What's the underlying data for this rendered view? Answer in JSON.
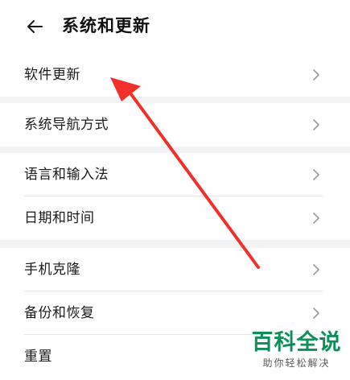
{
  "header": {
    "title": "系统和更新",
    "back_icon": "arrow-left-icon"
  },
  "groups": [
    {
      "items": [
        {
          "label": "软件更新"
        }
      ]
    },
    {
      "items": [
        {
          "label": "系统导航方式"
        }
      ]
    },
    {
      "items": [
        {
          "label": "语言和输入法"
        },
        {
          "label": "日期和时间"
        }
      ]
    },
    {
      "items": [
        {
          "label": "手机克隆"
        },
        {
          "label": "备份和恢复"
        },
        {
          "label": "重置"
        }
      ]
    }
  ],
  "annotation": {
    "icon": "red-arrow-icon",
    "color": "#f0302a"
  },
  "watermark": {
    "brand": "百科全说",
    "subtitle": "助你轻松解决",
    "color": "#0e8f5a"
  },
  "colors": {
    "background": "#ffffff",
    "group_gap": "#f1f3f5",
    "chevron": "#9a9a9a"
  }
}
